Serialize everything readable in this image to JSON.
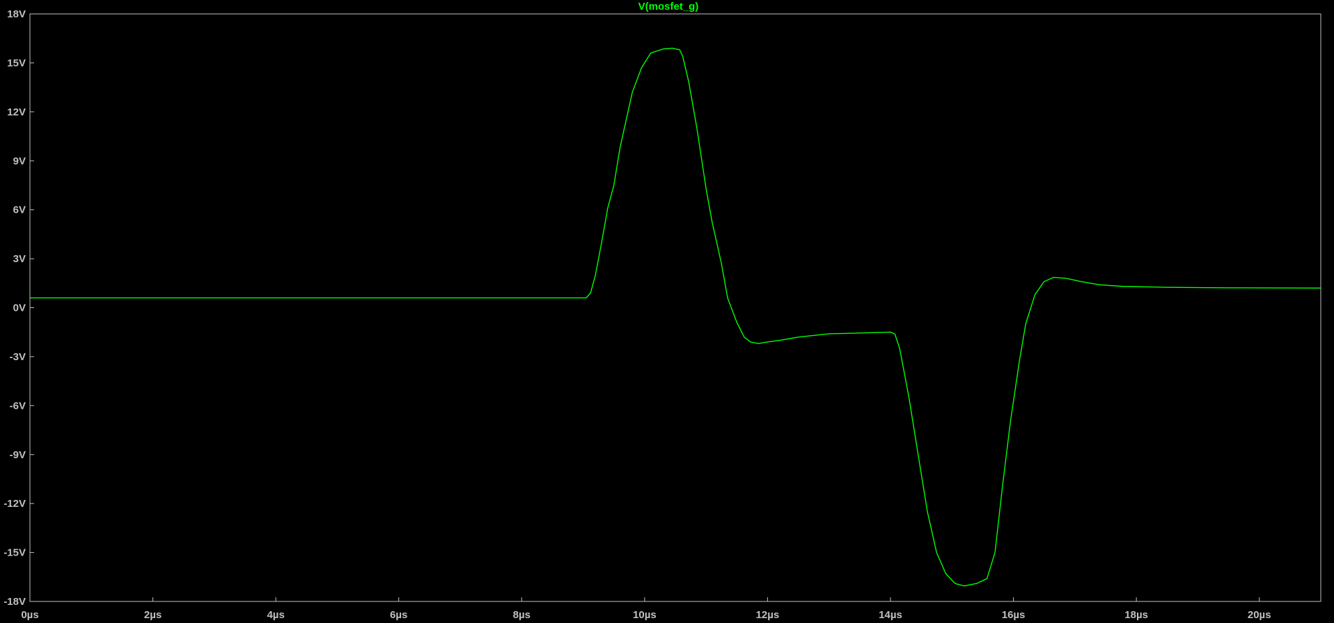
{
  "chart_data": {
    "type": "line",
    "title": "V(mosfet_g)",
    "xlabel": "",
    "ylabel": "",
    "xlim": [
      0,
      21
    ],
    "ylim": [
      -18,
      18
    ],
    "x_unit": "µs",
    "y_unit": "V",
    "grid": false,
    "x_ticks": [
      "0µs",
      "2µs",
      "4µs",
      "6µs",
      "8µs",
      "10µs",
      "12µs",
      "14µs",
      "16µs",
      "18µs",
      "20µs"
    ],
    "x_tick_values": [
      0,
      2,
      4,
      6,
      8,
      10,
      12,
      14,
      16,
      18,
      20
    ],
    "y_ticks": [
      "18V",
      "15V",
      "12V",
      "9V",
      "6V",
      "3V",
      "0V",
      "-3V",
      "-6V",
      "-9V",
      "-12V",
      "-15V",
      "-18V"
    ],
    "y_tick_values": [
      18,
      15,
      12,
      9,
      6,
      3,
      0,
      -3,
      -6,
      -9,
      -12,
      -15,
      -18
    ],
    "series": [
      {
        "name": "V(mosfet_g)",
        "color": "#00ff00",
        "points": [
          [
            0,
            0.6
          ],
          [
            9.05,
            0.6
          ],
          [
            9.12,
            0.9
          ],
          [
            9.2,
            2
          ],
          [
            9.3,
            4
          ],
          [
            9.4,
            6.1
          ],
          [
            9.5,
            7.5
          ],
          [
            9.6,
            9.8
          ],
          [
            9.8,
            13.2
          ],
          [
            9.95,
            14.7
          ],
          [
            10.1,
            15.6
          ],
          [
            10.3,
            15.85
          ],
          [
            10.45,
            15.9
          ],
          [
            10.57,
            15.8
          ],
          [
            10.62,
            15.4
          ],
          [
            10.72,
            13.8
          ],
          [
            10.85,
            11
          ],
          [
            11,
            7.3
          ],
          [
            11.1,
            5.2
          ],
          [
            11.25,
            2.7
          ],
          [
            11.35,
            0.6
          ],
          [
            11.5,
            -0.9
          ],
          [
            11.62,
            -1.8
          ],
          [
            11.72,
            -2.1
          ],
          [
            11.85,
            -2.2
          ],
          [
            12,
            -2.1
          ],
          [
            12.2,
            -2
          ],
          [
            12.5,
            -1.8
          ],
          [
            13,
            -1.6
          ],
          [
            13.5,
            -1.55
          ],
          [
            14,
            -1.5
          ],
          [
            14.07,
            -1.6
          ],
          [
            14.15,
            -2.5
          ],
          [
            14.3,
            -5.5
          ],
          [
            14.45,
            -9
          ],
          [
            14.6,
            -12.5
          ],
          [
            14.75,
            -15
          ],
          [
            14.9,
            -16.3
          ],
          [
            15.05,
            -16.9
          ],
          [
            15.2,
            -17.05
          ],
          [
            15.4,
            -16.9
          ],
          [
            15.57,
            -16.6
          ],
          [
            15.7,
            -15
          ],
          [
            15.82,
            -11
          ],
          [
            15.95,
            -7
          ],
          [
            16.1,
            -3.2
          ],
          [
            16.2,
            -1
          ],
          [
            16.35,
            0.8
          ],
          [
            16.5,
            1.6
          ],
          [
            16.65,
            1.85
          ],
          [
            16.85,
            1.8
          ],
          [
            17.1,
            1.6
          ],
          [
            17.4,
            1.4
          ],
          [
            17.8,
            1.3
          ],
          [
            18.5,
            1.25
          ],
          [
            19.5,
            1.22
          ],
          [
            21,
            1.2
          ]
        ]
      }
    ]
  }
}
